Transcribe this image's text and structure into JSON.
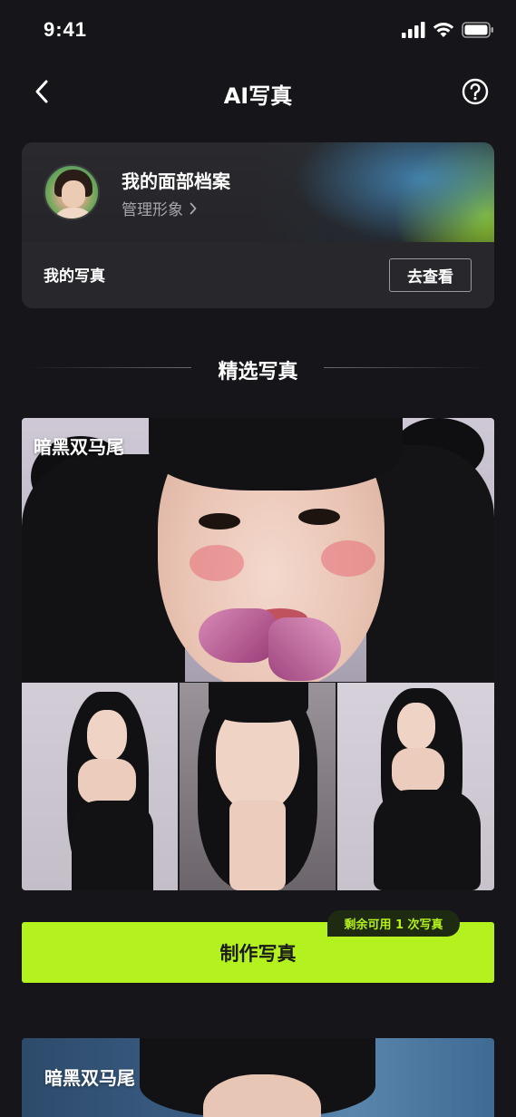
{
  "status_bar": {
    "time": "9:41"
  },
  "nav": {
    "title": "AI写真"
  },
  "profile": {
    "name": "我的面部档案",
    "manage_label": "管理形象",
    "my_photos_label": "我的写真",
    "view_button_label": "去查看"
  },
  "section": {
    "title": "精选写真"
  },
  "templates": [
    {
      "label": "暗黑双马尾"
    },
    {
      "label": "暗黑双马尾"
    }
  ],
  "create": {
    "button_label": "制作写真",
    "quota_label": "剩余可用 1 次写真"
  },
  "colors": {
    "accent": "#b3f21f",
    "background": "#161519",
    "card": "#28282c"
  }
}
